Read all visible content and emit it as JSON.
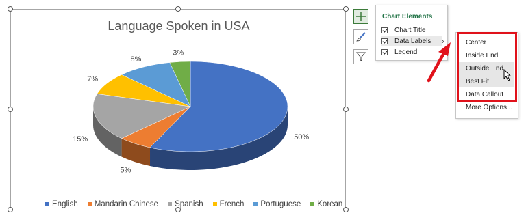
{
  "chart_data": {
    "type": "pie",
    "title": "Language Spoken in USA",
    "categories": [
      "English",
      "Mandarin Chinese",
      "Spanish",
      "French",
      "Portuguese",
      "Korean"
    ],
    "values": [
      50,
      5,
      15,
      7,
      8,
      3
    ],
    "data_labels": [
      "50%",
      "5%",
      "15%",
      "7%",
      "8%",
      "3%"
    ],
    "colors": [
      "#4472c4",
      "#ed7d31",
      "#a5a5a5",
      "#ffc000",
      "#5b9bd5",
      "#70ad47"
    ],
    "legend_position": "bottom",
    "style": "3d"
  },
  "chart_elements": {
    "title": "Chart Elements",
    "items": [
      {
        "label": "Chart Title",
        "checked": true
      },
      {
        "label": "Data Labels",
        "checked": true
      },
      {
        "label": "Legend",
        "checked": true
      }
    ]
  },
  "label_position_menu": {
    "items": [
      "Center",
      "Inside End",
      "Outside End",
      "Best Fit",
      "Data Callout",
      "More Options..."
    ],
    "hovered": "Outside End"
  },
  "side_buttons": [
    "chart-elements-plus-icon",
    "chart-styles-brush-icon",
    "chart-filters-funnel-icon"
  ]
}
